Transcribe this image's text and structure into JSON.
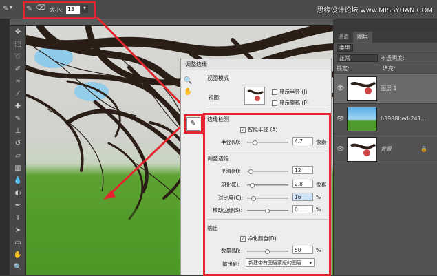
{
  "options_bar": {
    "size_label": "大小:",
    "size_value": "13",
    "dropdown_arrow": "▾"
  },
  "watermark": "思缘设计论坛 www.MISSYUAN.COM",
  "layers_panel": {
    "tabs": [
      "通道",
      "图层"
    ],
    "kind_label": "类型",
    "blend_mode": "正常",
    "opacity_label": "不透明度:",
    "lock_label": "锁定:",
    "fill_label": "填充:",
    "layers": [
      {
        "name": "图层 1"
      },
      {
        "name": "b3988bed-241..."
      },
      {
        "name": "背景"
      }
    ]
  },
  "dialog": {
    "title": "调整边缘",
    "view_mode": {
      "heading": "视图模式",
      "view_label": "视图:",
      "show_radius": "显示半径 (J)",
      "show_original": "显示原稿 (P)"
    },
    "edge_detection": {
      "heading": "边缘检测",
      "smart_radius": "智能半径 (A)",
      "radius_label": "半径(U):",
      "radius_value": "4.7",
      "radius_unit": "像素"
    },
    "adjust_edge": {
      "heading": "调整边缘",
      "smooth_label": "平滑(H):",
      "smooth_value": "12",
      "feather_label": "羽化(E):",
      "feather_value": "2.8",
      "feather_unit": "像素",
      "contrast_label": "对比度(C):",
      "contrast_value": "16",
      "contrast_unit": "%",
      "shift_label": "移动边缘(S):",
      "shift_value": "0",
      "shift_unit": "%"
    },
    "output": {
      "heading": "输出",
      "decontaminate": "净化颜色(D)",
      "amount_label": "数量(N):",
      "amount_value": "50",
      "amount_unit": "%",
      "output_to_label": "输出到:",
      "output_to_value": "新建带有图层蒙版的图层"
    }
  },
  "colors": {
    "highlight": "#e3262d",
    "panel": "#535353",
    "dialog": "#ededed"
  }
}
